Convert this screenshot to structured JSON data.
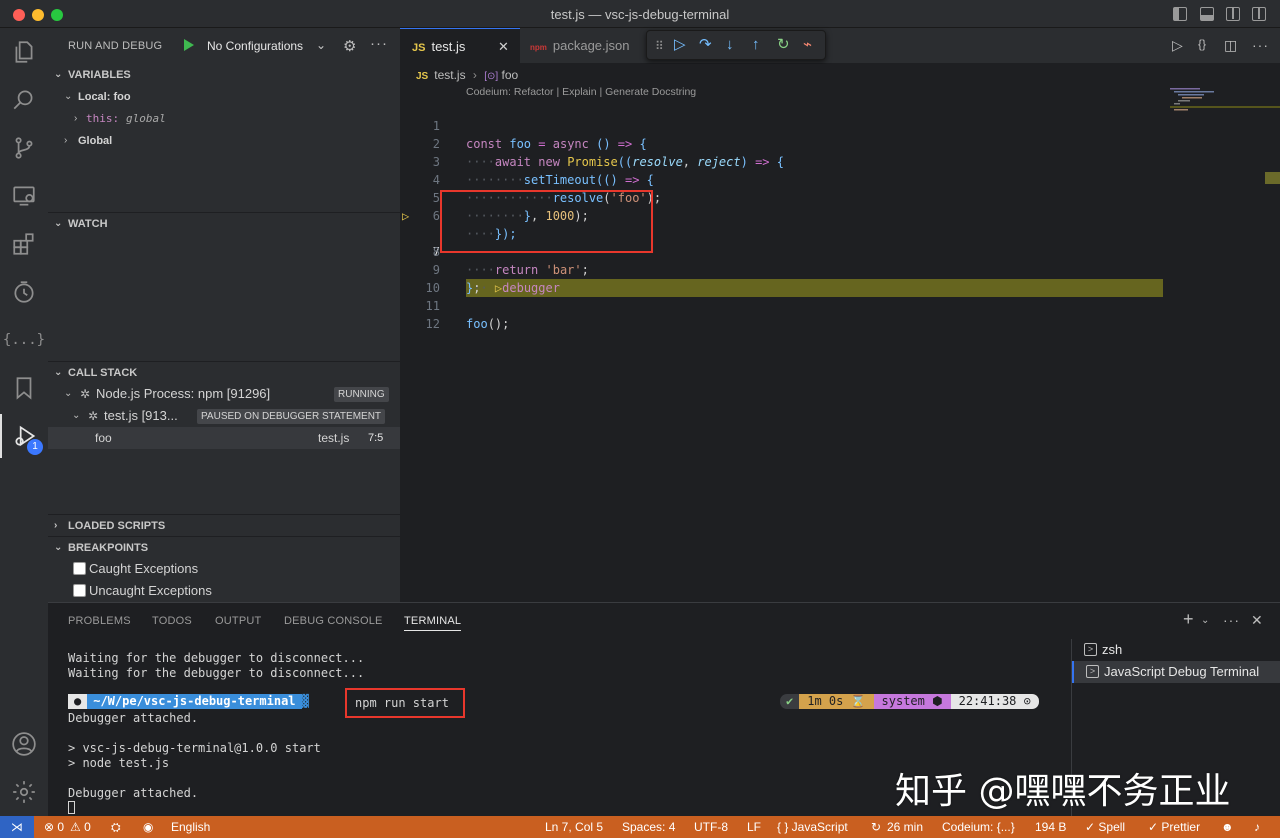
{
  "window": {
    "title": "test.js — vsc-js-debug-terminal"
  },
  "run_debug": {
    "title": "RUN AND DEBUG",
    "config": "No Configurations"
  },
  "variables": {
    "header": "VARIABLES",
    "local_label": "Local: foo",
    "this_name": "this:",
    "this_value": "global",
    "global_label": "Global"
  },
  "watch": {
    "header": "WATCH"
  },
  "call_stack": {
    "header": "CALL STACK",
    "process": "Node.js Process: npm [91296]",
    "process_status": "RUNNING",
    "thread": "test.js [913...",
    "thread_status": "PAUSED ON DEBUGGER STATEMENT",
    "frame_name": "foo",
    "frame_file": "test.js",
    "frame_pos": "7:5"
  },
  "loaded_scripts": {
    "header": "LOADED SCRIPTS"
  },
  "breakpoints": {
    "header": "BREAKPOINTS",
    "items": [
      "Caught Exceptions",
      "Uncaught Exceptions"
    ]
  },
  "activity_bar": {
    "icons": [
      "files-icon",
      "search-icon",
      "source-control-icon",
      "remote-explorer-icon",
      "extensions-icon",
      "timeline-icon",
      "json-icon",
      "bookmark-icon",
      "run-debug-icon",
      "account-icon",
      "settings-icon"
    ],
    "debug_badge": "1",
    "json_text": "{...}"
  },
  "tabs": {
    "active": "test.js",
    "other": "package.json",
    "active_icon_text": "JS",
    "other_icon_text": "npm"
  },
  "breadcrumb": {
    "file": "test.js",
    "symbol": "foo"
  },
  "codelens": "Codeium: Refactor | Explain | Generate Docstring",
  "editor": {
    "current_line": 7,
    "line_numbers": [
      "1",
      "2",
      "3",
      "4",
      "5",
      "6",
      "7",
      "8",
      "9",
      "10",
      "11",
      "12"
    ]
  },
  "panel": {
    "tabs": [
      "PROBLEMS",
      "TODOS",
      "OUTPUT",
      "DEBUG CONSOLE",
      "TERMINAL"
    ],
    "active_tab": "TERMINAL"
  },
  "terminal": {
    "lines_top": [
      "Waiting for the debugger to disconnect...",
      "Waiting for the debugger to disconnect..."
    ],
    "prompt_path": "~/W/pe/vsc-js-debug-terminal",
    "command": "npm run start",
    "attached_1": "Debugger attached.",
    "script_lines": [
      "> vsc-js-debug-terminal@1.0.0 start",
      "> node test.js"
    ],
    "attached_2": "Debugger attached.",
    "rprompt_ok": "✔",
    "rprompt_time": "1m 0s ⌛",
    "rprompt_node": "system ⬢",
    "rprompt_clock": "22:41:38 ⊙",
    "sessions": [
      "zsh",
      "JavaScript Debug Terminal"
    ]
  },
  "watermark": "知乎 @嘿嘿不务正业",
  "status_bar": {
    "errors": "⊗ 0",
    "warnings": "⚠ 0",
    "language_locale": "English",
    "cursor": "Ln 7, Col 5",
    "spaces": "Spaces: 4",
    "encoding": "UTF-8",
    "eol": "LF",
    "language": "{ } JavaScript",
    "time": "26 min",
    "codeium": "Codeium: {...}",
    "size": "194 B",
    "spell": "✓ Spell",
    "prettier": "✓ Prettier"
  },
  "colors": {
    "status_bar_debug": "#c95f20",
    "accent": "#3574f0",
    "debug_line": "#66651f"
  }
}
